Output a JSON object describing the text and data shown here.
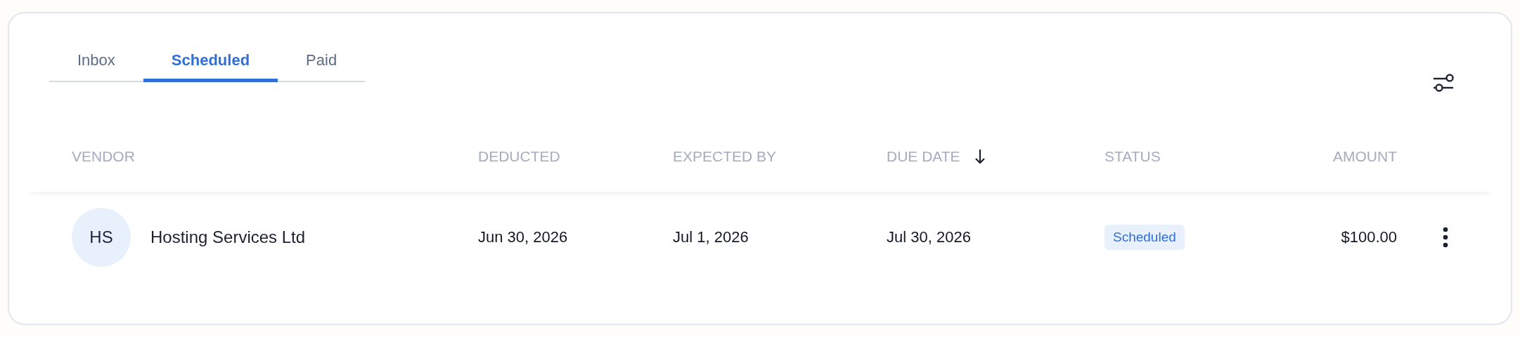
{
  "tabs": [
    {
      "label": "Inbox",
      "selected": false
    },
    {
      "label": "Scheduled",
      "selected": true
    },
    {
      "label": "Paid",
      "selected": false
    }
  ],
  "table": {
    "columns": [
      {
        "label": "VENDOR",
        "sorted": false
      },
      {
        "label": "DEDUCTED",
        "sorted": false
      },
      {
        "label": "EXPECTED BY",
        "sorted": false
      },
      {
        "label": "DUE DATE",
        "sorted": true
      },
      {
        "label": "STATUS",
        "sorted": false
      },
      {
        "label": "AMOUNT",
        "sorted": false
      }
    ],
    "rows": [
      {
        "initials": "HS",
        "vendor": "Hosting Services Ltd",
        "deducted": "Jun 30, 2026",
        "expected_by": "Jul 1, 2026",
        "due_date": "Jul 30, 2026",
        "status": "Scheduled",
        "amount": "$100.00"
      }
    ]
  }
}
